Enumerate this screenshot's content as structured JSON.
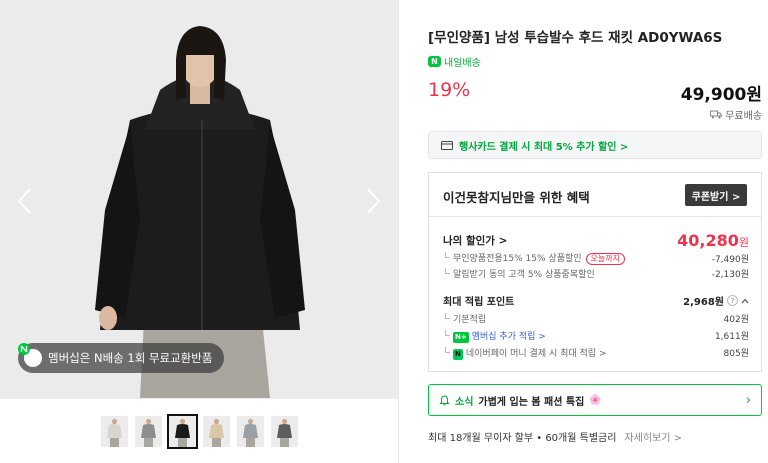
{
  "gallery": {
    "member_badge_text": "멤버십은 N배송 1회 무료교환반품",
    "thumbnail_count": 6,
    "active_thumbnail": 3,
    "thumbnail_colors": [
      "#d8d6cf",
      "#8e8e8e",
      "#1a1a1a",
      "#d9c8a8",
      "#9aa0a6",
      "#5d5d5d"
    ]
  },
  "product": {
    "title": "[무인양품] 남성 투습발수 후드 재킷 AD0YWA6S",
    "delivery_label": "내일배송",
    "delivery_logo": "N",
    "discount": "19%",
    "price": "49,900원",
    "shipping": "무료배송"
  },
  "card_promo": {
    "text": "행사카드 결제 시 최대 5% 추가 할인 >"
  },
  "benefit": {
    "title": "이건못참지님만을 위한 혜택",
    "coupon_button": "쿠폰받기 >",
    "my_price_label": "나의 할인가 >",
    "my_price_value": "40,280",
    "my_price_unit": "원",
    "discount_rows": [
      {
        "label": "무인양품전용15% 15% 상품할인",
        "tag": "오늘까지",
        "value": "-7,490원"
      },
      {
        "label": "알림받기 동의 고객 5% 상품중복할인",
        "tag": "",
        "value": "-2,130원"
      }
    ],
    "points_label": "최대 적립 포인트",
    "points_value": "2,968원",
    "point_rows": [
      {
        "badge": "",
        "label": "기본적립",
        "value": "402원",
        "link": false
      },
      {
        "badge": "N+",
        "label": "멤버십 추가 적립 >",
        "value": "1,611원",
        "link": true
      },
      {
        "badge": "N",
        "label": "네이버페이 머니 결제 시 최대 적립 >",
        "value": "805원",
        "link": false
      }
    ]
  },
  "spring_promo": {
    "tag": "소식",
    "text": "가볍게 입는 봄 패션 특집",
    "emoji": "🌸"
  },
  "installment": {
    "text": "최대 18개월 무이자 할부 • 60개월 특별금리",
    "more": "자세히보기 >"
  }
}
